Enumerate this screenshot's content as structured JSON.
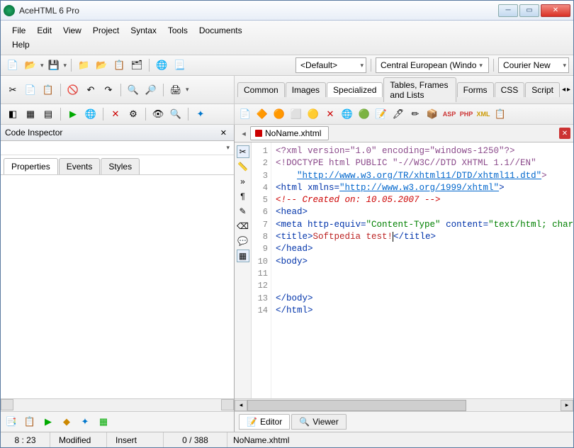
{
  "window": {
    "title": "AceHTML 6 Pro"
  },
  "menu": [
    "File",
    "Edit",
    "View",
    "Project",
    "Syntax",
    "Tools",
    "Documents",
    "Help"
  ],
  "dropdowns": {
    "profile": "<Default>",
    "encoding": "Central European (Windo",
    "font": "Courier New"
  },
  "editor_tabs": [
    "Common",
    "Images",
    "Specialized",
    "Tables, Frames and Lists",
    "Forms",
    "CSS",
    "Script"
  ],
  "editor_tabs_active": 2,
  "inspector": {
    "title": "Code Inspector",
    "tabs": [
      "Properties",
      "Events",
      "Styles"
    ],
    "active": 0
  },
  "file_tab": "NoName.xhtml",
  "view_tabs": {
    "editor": "Editor",
    "viewer": "Viewer"
  },
  "status": {
    "pos": "8 : 23",
    "modified": "Modified",
    "mode": "Insert",
    "count": "0 / 388",
    "file": "NoName.xhtml"
  },
  "code": {
    "lines": 14,
    "l1": "<?xml version=\"1.0\" encoding=\"windows-1250\"?>",
    "l2a": "<!DOCTYPE html PUBLIC ",
    "l2b": "\"-//W3C//DTD XHTML 1.1//EN\"",
    "l3": "\"http://www.w3.org/TR/xhtml11/DTD/xhtml11.dtd\"",
    "l4a": "<html xmlns=",
    "l4b": "\"http://www.w3.org/1999/xhtml\"",
    "l5": "<!-- Created on: 10.05.2007 -->",
    "l6": "<head>",
    "l7a": "<meta http-equiv=",
    "l7b": "\"Content-Type\"",
    "l7c": " content=",
    "l7d": "\"text/html; charse",
    "l8a": "<title>",
    "l8b": "Softpedia test!",
    "l8c": "</title>",
    "l9": "</head>",
    "l10": "<body>",
    "l13": "</body>",
    "l14": "</html>"
  }
}
